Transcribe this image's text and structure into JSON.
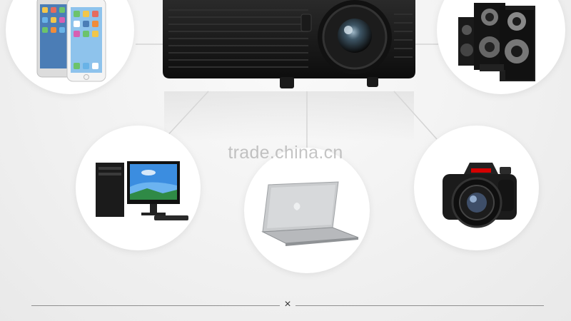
{
  "watermark": {
    "text": "trade.china.cn"
  },
  "divider": {
    "mark": "×"
  },
  "icons": {
    "projector": "projector",
    "phones": "smartphones",
    "speakers": "speakers",
    "desktop": "desktop-computer",
    "laptop": "laptop",
    "camera": "dslr-camera"
  },
  "colors": {
    "background": "#efefef",
    "device_black": "#141414",
    "bubble": "#ffffff"
  }
}
